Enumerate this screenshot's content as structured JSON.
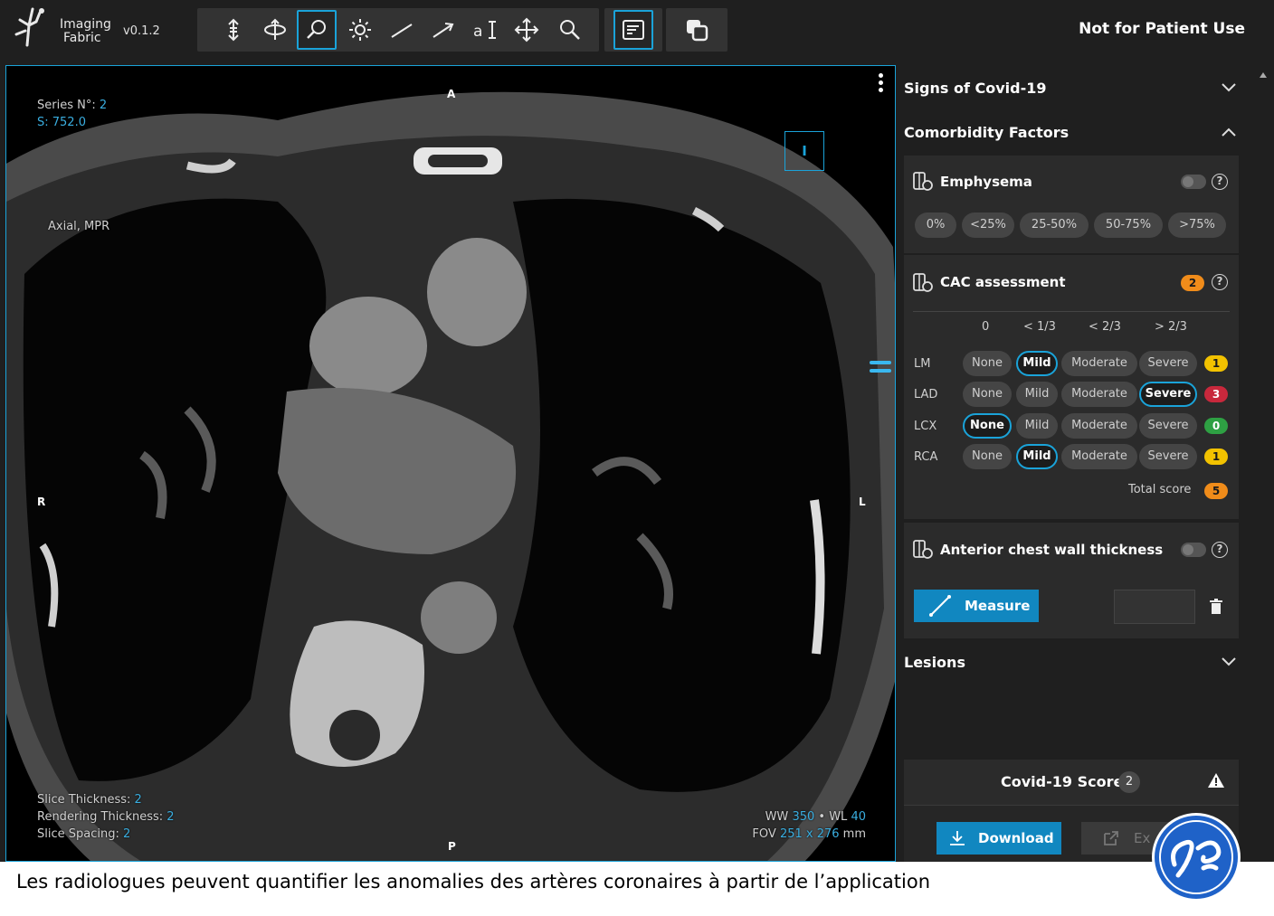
{
  "app": {
    "name_line1": "Imaging",
    "name_line2": "Fabric",
    "version": "v0.1.2",
    "notice": "Not for Patient Use"
  },
  "toolbar": {
    "tools": [
      {
        "name": "scroll-tool",
        "icon": "vertical-arrows-icon",
        "active": false
      },
      {
        "name": "rotate-tool",
        "icon": "rotate-3d-icon",
        "active": false
      },
      {
        "name": "zoom-tool",
        "icon": "magnifier-icon",
        "active": true
      },
      {
        "name": "window-level-tool",
        "icon": "brightness-icon",
        "active": false
      },
      {
        "name": "line-tool",
        "icon": "line-icon",
        "active": false
      },
      {
        "name": "arrow-tool",
        "icon": "arrow-icon",
        "active": false
      },
      {
        "name": "text-tool",
        "icon": "text-annotation-icon",
        "active": false
      },
      {
        "name": "pan-tool",
        "icon": "move-icon",
        "active": false
      },
      {
        "name": "search-tool",
        "icon": "search-icon",
        "active": false
      }
    ],
    "report_icon": "report-icon",
    "layers_icon": "layers-icon"
  },
  "viewer": {
    "series_label": "Series N°:",
    "series_value": "2",
    "slice_label": "S: 752.0",
    "view_label": "Axial, MPR",
    "orientation": {
      "top": "A",
      "bottom": "P",
      "left": "R",
      "right": "L"
    },
    "ibox_label": "I",
    "slice_thickness_label": "Slice Thickness:",
    "slice_thickness_value": "2",
    "rendering_thickness_label": "Rendering Thickness:",
    "rendering_thickness_value": "2",
    "slice_spacing_label": "Slice Spacing:",
    "slice_spacing_value": "2",
    "ww_label": "WW",
    "ww_value": "350",
    "wl_label": "WL",
    "wl_value": "40",
    "fov_label": "FOV",
    "fov_value": "251 x 276",
    "fov_unit": "mm"
  },
  "panel": {
    "signs_title": "Signs of Covid-19",
    "comorbidity_title": "Comorbidity Factors",
    "emphysema": {
      "title": "Emphysema",
      "options": [
        "0%",
        "<25%",
        "25-50%",
        "50-75%",
        ">75%"
      ]
    },
    "cac": {
      "title": "CAC assessment",
      "badge": "2",
      "col_heads": [
        "0",
        "< 1/3",
        "< 2/3",
        "> 2/3"
      ],
      "levels": [
        "None",
        "Mild",
        "Moderate",
        "Severe"
      ],
      "rows": [
        {
          "label": "LM",
          "selected": 1,
          "score": "1",
          "score_color": "#f2c200"
        },
        {
          "label": "LAD",
          "selected": 3,
          "score": "3",
          "score_color": "#c8283c"
        },
        {
          "label": "LCX",
          "selected": 0,
          "score": "0",
          "score_color": "#2ea043"
        },
        {
          "label": "RCA",
          "selected": 1,
          "score": "1",
          "score_color": "#f2c200"
        }
      ],
      "total_label": "Total score",
      "total_value": "5",
      "total_color": "#f08c1a"
    },
    "chest": {
      "title": "Anterior chest wall thickness",
      "measure_label": "Measure"
    },
    "lesions_title": "Lesions",
    "covid_score_label": "Covid-19 Score",
    "covid_score_value": "2",
    "download_label": "Download",
    "export_label": "Ex"
  },
  "caption": "Les radiologues peuvent quantifier les anomalies des artères coronaires à partir de l’application",
  "colors": {
    "accent": "#1aa3d9",
    "panel_bg": "#1f1f1f",
    "card_bg": "#2b2b2b",
    "ge_blue": "#1f62c8"
  }
}
